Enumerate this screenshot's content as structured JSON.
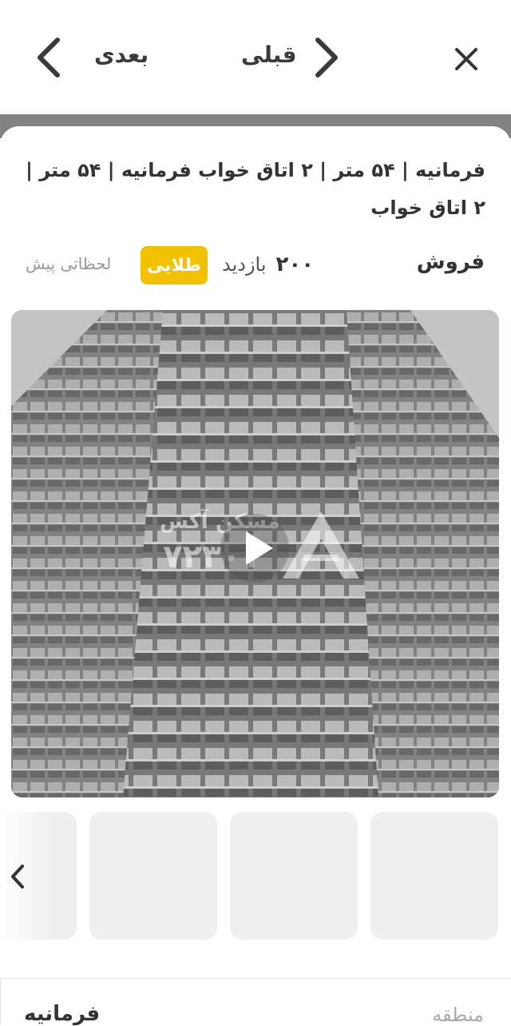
{
  "header": {
    "next_label": "بعدی",
    "prev_label": "قبلی",
    "close_icon": "close-icon"
  },
  "listing": {
    "title": "فرمانیه  |  ۵۴ متر  |  ۲ اتاق خواب فرمانیه  |  ۵۴ متر  |  ۲ اتاق خواب",
    "type": "فروش",
    "views_count": "۲۰۰",
    "views_label": "بازدید",
    "badge": "طلایی",
    "badge_color": "#f2c200",
    "time": "لحظاتی پیش"
  },
  "media": {
    "watermark_brand": "مسکن آکس",
    "watermark_code": "۷۲۳۰۱",
    "play_icon": "play-icon"
  },
  "thumbnails": {
    "arrow_icon": "chevron-left-icon"
  },
  "details": {
    "rows": [
      {
        "key": "منطقه",
        "value": "فرمانیه"
      }
    ]
  }
}
